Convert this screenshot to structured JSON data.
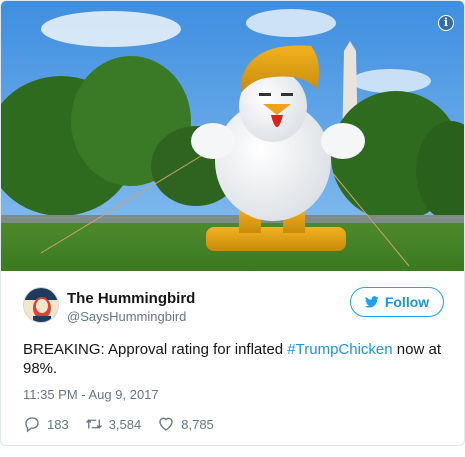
{
  "tweet": {
    "author_name": "The Hummingbird",
    "author_handle": "@SaysHummingbird",
    "follow_label": "Follow",
    "text_prefix": "BREAKING: Approval rating for inflated ",
    "hashtag": "#TrumpChicken",
    "text_suffix": " now at 98%.",
    "timestamp": "11:35 PM - Aug 9, 2017",
    "reply_count": "183",
    "retweet_count": "3,584",
    "like_count": "8,785"
  },
  "media": {
    "info_glyph": "i"
  },
  "colors": {
    "accent": "#1da1f2",
    "link": "#1b95e0",
    "muted": "#657786",
    "border": "#e1e8ed"
  },
  "icons": {
    "info": "info-icon",
    "bird": "twitter-bird-icon",
    "reply": "reply-icon",
    "retweet": "retweet-icon",
    "like": "heart-icon"
  }
}
